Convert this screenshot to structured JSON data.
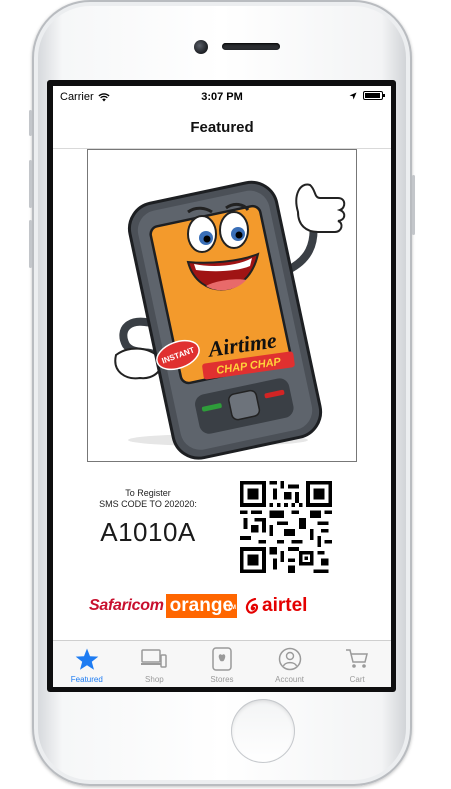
{
  "status_bar": {
    "carrier": "Carrier",
    "time": "3:07 PM"
  },
  "nav": {
    "title": "Featured"
  },
  "artwork": {
    "badge_text": "INSTANT",
    "brand_text": "Airtime",
    "tagline_text": "CHAP CHAP"
  },
  "register": {
    "line1": "To Register",
    "line2": "SMS CODE TO 202020:",
    "code": "A1010A"
  },
  "carriers": {
    "safaricom": "Safaricom",
    "orange": "orange",
    "orange_tm": "TM",
    "airtel": "airtel"
  },
  "tab_bar": {
    "items": [
      {
        "label": "Featured",
        "icon": "star-icon",
        "active": true
      },
      {
        "label": "Shop",
        "icon": "devices-icon",
        "active": false
      },
      {
        "label": "Stores",
        "icon": "stores-icon",
        "active": false
      },
      {
        "label": "Account",
        "icon": "account-icon",
        "active": false
      },
      {
        "label": "Cart",
        "icon": "cart-icon",
        "active": false
      }
    ]
  },
  "colors": {
    "accent": "#1e7cf2",
    "phone_orange": "#f39a2c",
    "airtel_red": "#e40000",
    "orange_brand": "#ff6600",
    "safaricom_green": "#4a9d2f"
  }
}
